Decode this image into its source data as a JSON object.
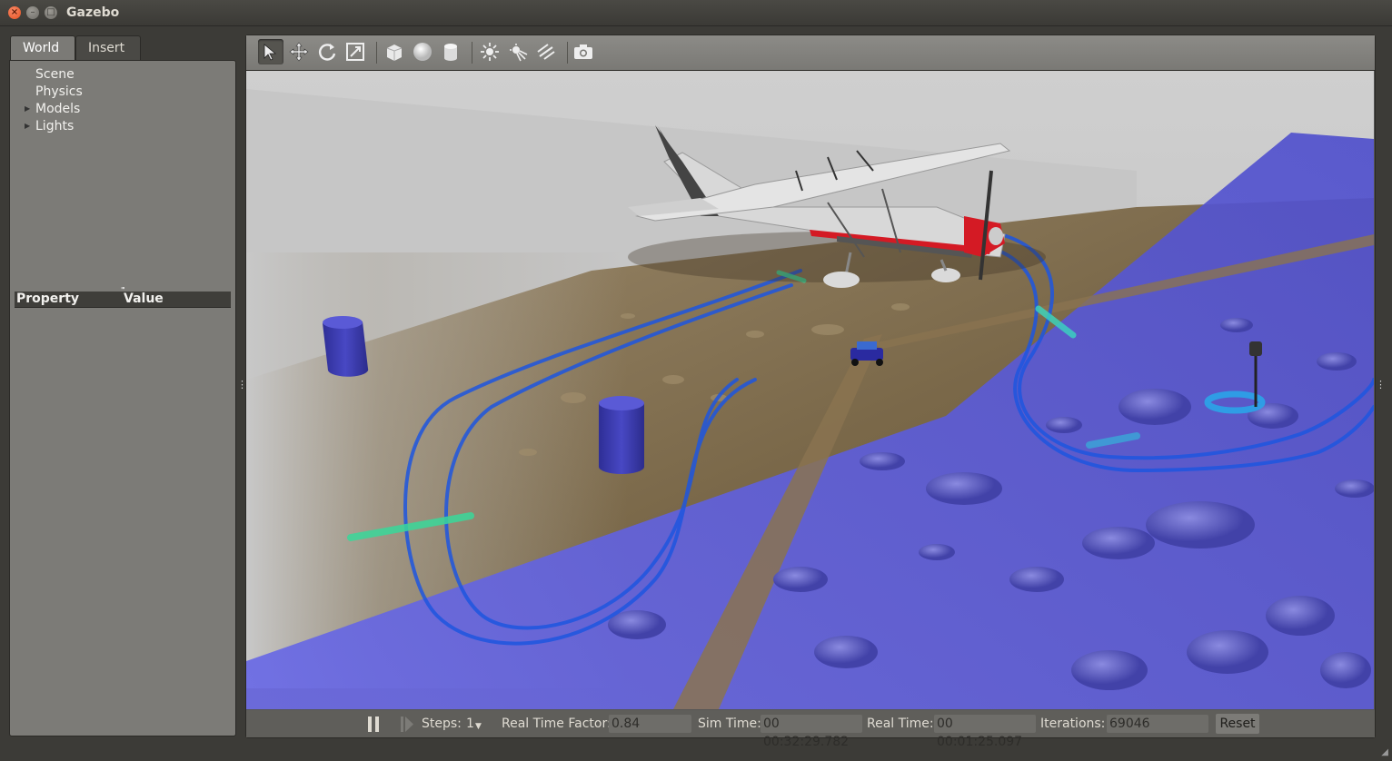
{
  "window": {
    "title": "Gazebo"
  },
  "left_panel": {
    "tabs": [
      {
        "label": "World",
        "active": true
      },
      {
        "label": "Insert",
        "active": false
      }
    ],
    "tree": [
      {
        "label": "Scene",
        "expandable": false
      },
      {
        "label": "Physics",
        "expandable": false
      },
      {
        "label": "Models",
        "expandable": true
      },
      {
        "label": "Lights",
        "expandable": true
      }
    ],
    "property_table": {
      "col_property": "Property",
      "col_value": "Value"
    }
  },
  "toolbar": {
    "tools": [
      {
        "icon": "select-arrow-icon",
        "active": true
      },
      {
        "icon": "translate-icon",
        "active": false
      },
      {
        "icon": "rotate-icon",
        "active": false
      },
      {
        "icon": "scale-icon",
        "active": false
      },
      {
        "icon": "box-shape-icon",
        "active": false
      },
      {
        "icon": "sphere-shape-icon",
        "active": false
      },
      {
        "icon": "cylinder-shape-icon",
        "active": false
      },
      {
        "icon": "point-light-icon",
        "active": false
      },
      {
        "icon": "spot-light-icon",
        "active": false
      },
      {
        "icon": "directional-light-icon",
        "active": false
      },
      {
        "icon": "screenshot-icon",
        "active": false
      }
    ]
  },
  "status": {
    "steps_label": "Steps:",
    "steps_value": "1",
    "rtf_label": "Real Time Factor:",
    "rtf_value": "0.84",
    "sim_time_label": "Sim Time:",
    "sim_time_value": "00 00:32:29.782",
    "real_time_label": "Real Time:",
    "real_time_value": "00 00:01:25.097",
    "iterations_label": "Iterations:",
    "iterations_value": "69046",
    "reset_label": "Reset"
  },
  "colors": {
    "ground_plane_overlay": "#5a5ad8",
    "path_blue": "#1e56e0",
    "marker_green": "#3ad89a",
    "cylinder_blue": "#3c3cb4",
    "plane_red": "#d41a24"
  }
}
